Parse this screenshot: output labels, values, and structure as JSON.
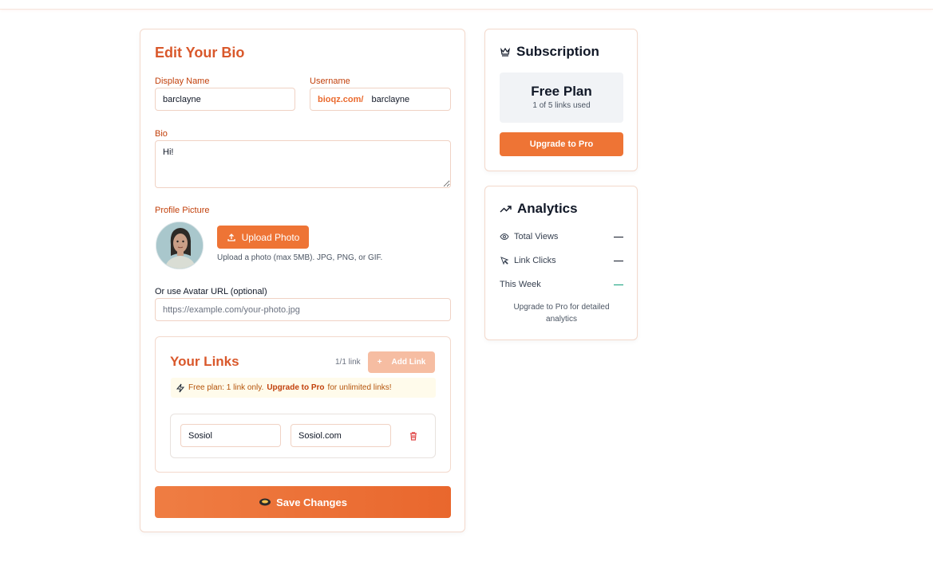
{
  "editor": {
    "title": "Edit Your Bio",
    "display_name_label": "Display Name",
    "display_name_value": "barclayne",
    "username_label": "Username",
    "username_prefix": "bioqz.com/",
    "username_value": "barclayne",
    "bio_label": "Bio",
    "bio_value": "Hi!",
    "profile_picture_label": "Profile Picture",
    "upload_button_label": "Upload Photo",
    "upload_hint": "Upload a photo (max 5MB). JPG, PNG, or GIF.",
    "avatar_url_label": "Or use Avatar URL (optional)",
    "avatar_url_placeholder": "https://example.com/your-photo.jpg",
    "save_button_label": "Save Changes"
  },
  "links": {
    "title": "Your Links",
    "count": "1/1 link",
    "add_button_label": "Add Link",
    "notice_prefix": "Free plan: 1 link only.",
    "notice_upgrade": "Upgrade to Pro",
    "notice_suffix": "for unlimited links!",
    "items": [
      {
        "title": "Sosiol",
        "url": "Sosiol.com"
      }
    ]
  },
  "subscription": {
    "title": "Subscription",
    "plan_name": "Free Plan",
    "plan_usage": "1 of 5 links used",
    "upgrade_button_label": "Upgrade to Pro"
  },
  "analytics": {
    "title": "Analytics",
    "total_views_label": "Total Views",
    "link_clicks_label": "Link Clicks",
    "this_week_label": "This Week",
    "hint": "Upgrade to Pro for detailed analytics"
  },
  "colors": {
    "accent": "#ee7435",
    "title_orange": "#d9582b",
    "growth_green": "#0f9f7a"
  },
  "icons": [
    "upload-icon",
    "plus-icon",
    "lightning-icon",
    "trash-icon",
    "save-icon",
    "crown-icon",
    "trending-up-icon",
    "eye-icon",
    "cursor-icon"
  ]
}
